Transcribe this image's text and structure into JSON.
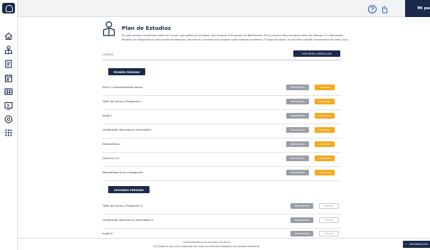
{
  "topbar": {
    "help_icon": "question-circle-icon",
    "hand_icon": "hand-icon",
    "profile_label": "Mi perfil"
  },
  "sidebar": {
    "logo_icon": "shield-logo-icon",
    "items": [
      {
        "icon": "home-icon"
      },
      {
        "icon": "graduation-icon"
      },
      {
        "icon": "document-icon"
      },
      {
        "icon": "calendar-icon"
      },
      {
        "icon": "grid-table-icon"
      },
      {
        "icon": "monitor-icon"
      },
      {
        "icon": "at-sign-icon"
      },
      {
        "icon": "apps-grid-icon"
      }
    ]
  },
  "header": {
    "icon": "student-icon",
    "title": "Plan de Estudios",
    "description": "En esta sección encontrarás todos los Cursos, agrupados por periodos, que integran el Programa de Bachillerato. En la columna derecha observarás dos botones. En Información tendrás a tu disposición la descripción de objetivos, estructura y recursos que integran cada material académico. El segundo botón, te permitirá solicitar la activación de cada curso."
  },
  "courses": {
    "label": "CURSOS",
    "mallas_button": "VER MAPA CURRICULAR"
  },
  "periods": [
    {
      "label": "PRIMER PERIODO",
      "courses": [
        {
          "name": "Ética y Comportamiento alpura",
          "info": "Información",
          "action": "Comenzar",
          "state": "start"
        },
        {
          "name": "Taller de Lectura y Redacción I",
          "info": "Información",
          "action": "Comenzar",
          "state": "start"
        },
        {
          "name": "Inglés I",
          "info": "Información",
          "action": "Comenzar",
          "state": "start"
        },
        {
          "name": "Certificación Ejecutiva en Informática I",
          "info": "Información",
          "action": "Comenzar",
          "state": "start"
        },
        {
          "name": "Matemáticas I",
          "info": "Información",
          "action": "Comenzar",
          "state": "start"
        },
        {
          "name": "Química I y II",
          "info": "Información",
          "action": "Comenzar",
          "state": "start"
        },
        {
          "name": "Metodología de la investigación",
          "info": "Información",
          "action": "Comenzar",
          "state": "start"
        }
      ]
    },
    {
      "label": "SEGUNDO PERIODO",
      "courses": [
        {
          "name": "Taller de Lectura y Redacción II",
          "info": "Información",
          "action": "Activar",
          "state": "inactive"
        },
        {
          "name": "Certificación Ejecutiva en Informática II",
          "info": "Información",
          "action": "Activar",
          "state": "inactive"
        },
        {
          "name": "Inglés II",
          "info": "Información",
          "action": "Activar",
          "state": "inactive"
        }
      ]
    }
  ],
  "footer": {
    "line1": "Universidad alpura es una marca de alpura",
    "line2": "All College es una marca registrada con todos sus derechos protegidos de propiedad intelectual",
    "info_tab": "INFORMACIÓN",
    "info_tab_icon": "arrow-left-icon"
  },
  "colors": {
    "navy": "#1b2a4a",
    "orange": "#f5a81c",
    "gray_button": "#9a9ea6"
  }
}
